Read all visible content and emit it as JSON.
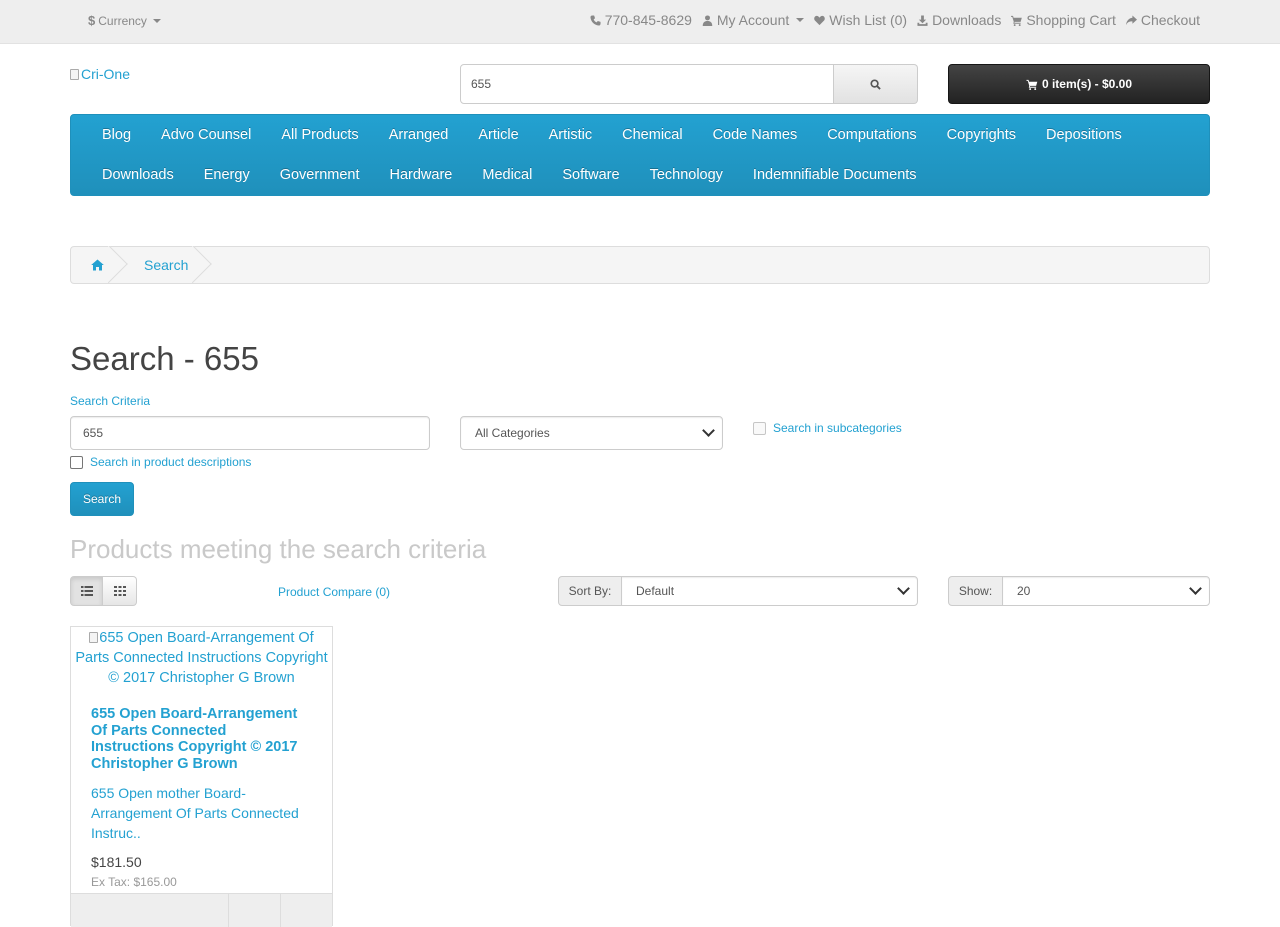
{
  "top_bar": {
    "currency_symbol": "$",
    "currency_label": "Currency",
    "phone": "770-845-8629",
    "my_account": "My Account",
    "wish_list": "Wish List (0)",
    "downloads": "Downloads",
    "shopping_cart": "Shopping Cart",
    "checkout": "Checkout"
  },
  "header": {
    "logo_alt": "Cri-One",
    "search_value": "655",
    "cart_label": "0 item(s) - $0.00"
  },
  "menu": {
    "items": [
      "Blog",
      "Advo Counsel",
      "All Products",
      "Arranged",
      "Article",
      "Artistic",
      "Chemical",
      "Code Names",
      "Computations",
      "Copyrights",
      "Depositions",
      "Downloads",
      "Energy",
      "Government",
      "Hardware",
      "Medical",
      "Software",
      "Technology",
      "Indemnifiable Documents"
    ]
  },
  "breadcrumb": {
    "current": "Search"
  },
  "search_page": {
    "title": "Search - 655",
    "criteria_label": "Search Criteria",
    "criteria_value": "655",
    "category_selected": "All Categories",
    "subcategories_label": "Search in subcategories",
    "descriptions_label": "Search in product descriptions",
    "search_button": "Search",
    "results_heading": "Products meeting the search criteria",
    "compare_link": "Product Compare (0)",
    "sort_label": "Sort By:",
    "sort_selected": "Default",
    "show_label": "Show:",
    "show_selected": "20"
  },
  "product": {
    "image_alt": "655 Open Board-Arrangement Of Parts Connected Instructions Copyright © 2017 Christopher G Brown",
    "name": "655 Open Board-Arrangement Of Parts Connected Instructions Copyright © 2017 Christopher G Brown",
    "description": "655 Open mother Board-Arrangement Of Parts Connected Instruc..",
    "price": "$181.50",
    "ex_tax": "Ex Tax: $165.00"
  },
  "colors": {
    "accent": "#23a1d1",
    "cart_button": "#222222",
    "top_bar_bg": "#eeeeee"
  },
  "icons": {
    "phone": "phone-icon",
    "account": "user-icon",
    "wish_list": "heart-icon",
    "downloads": "download-icon",
    "cart": "shopping-cart-icon",
    "checkout": "share-icon",
    "search": "search-icon",
    "home": "home-icon",
    "list_view": "list-icon",
    "grid_view": "grid-icon"
  }
}
